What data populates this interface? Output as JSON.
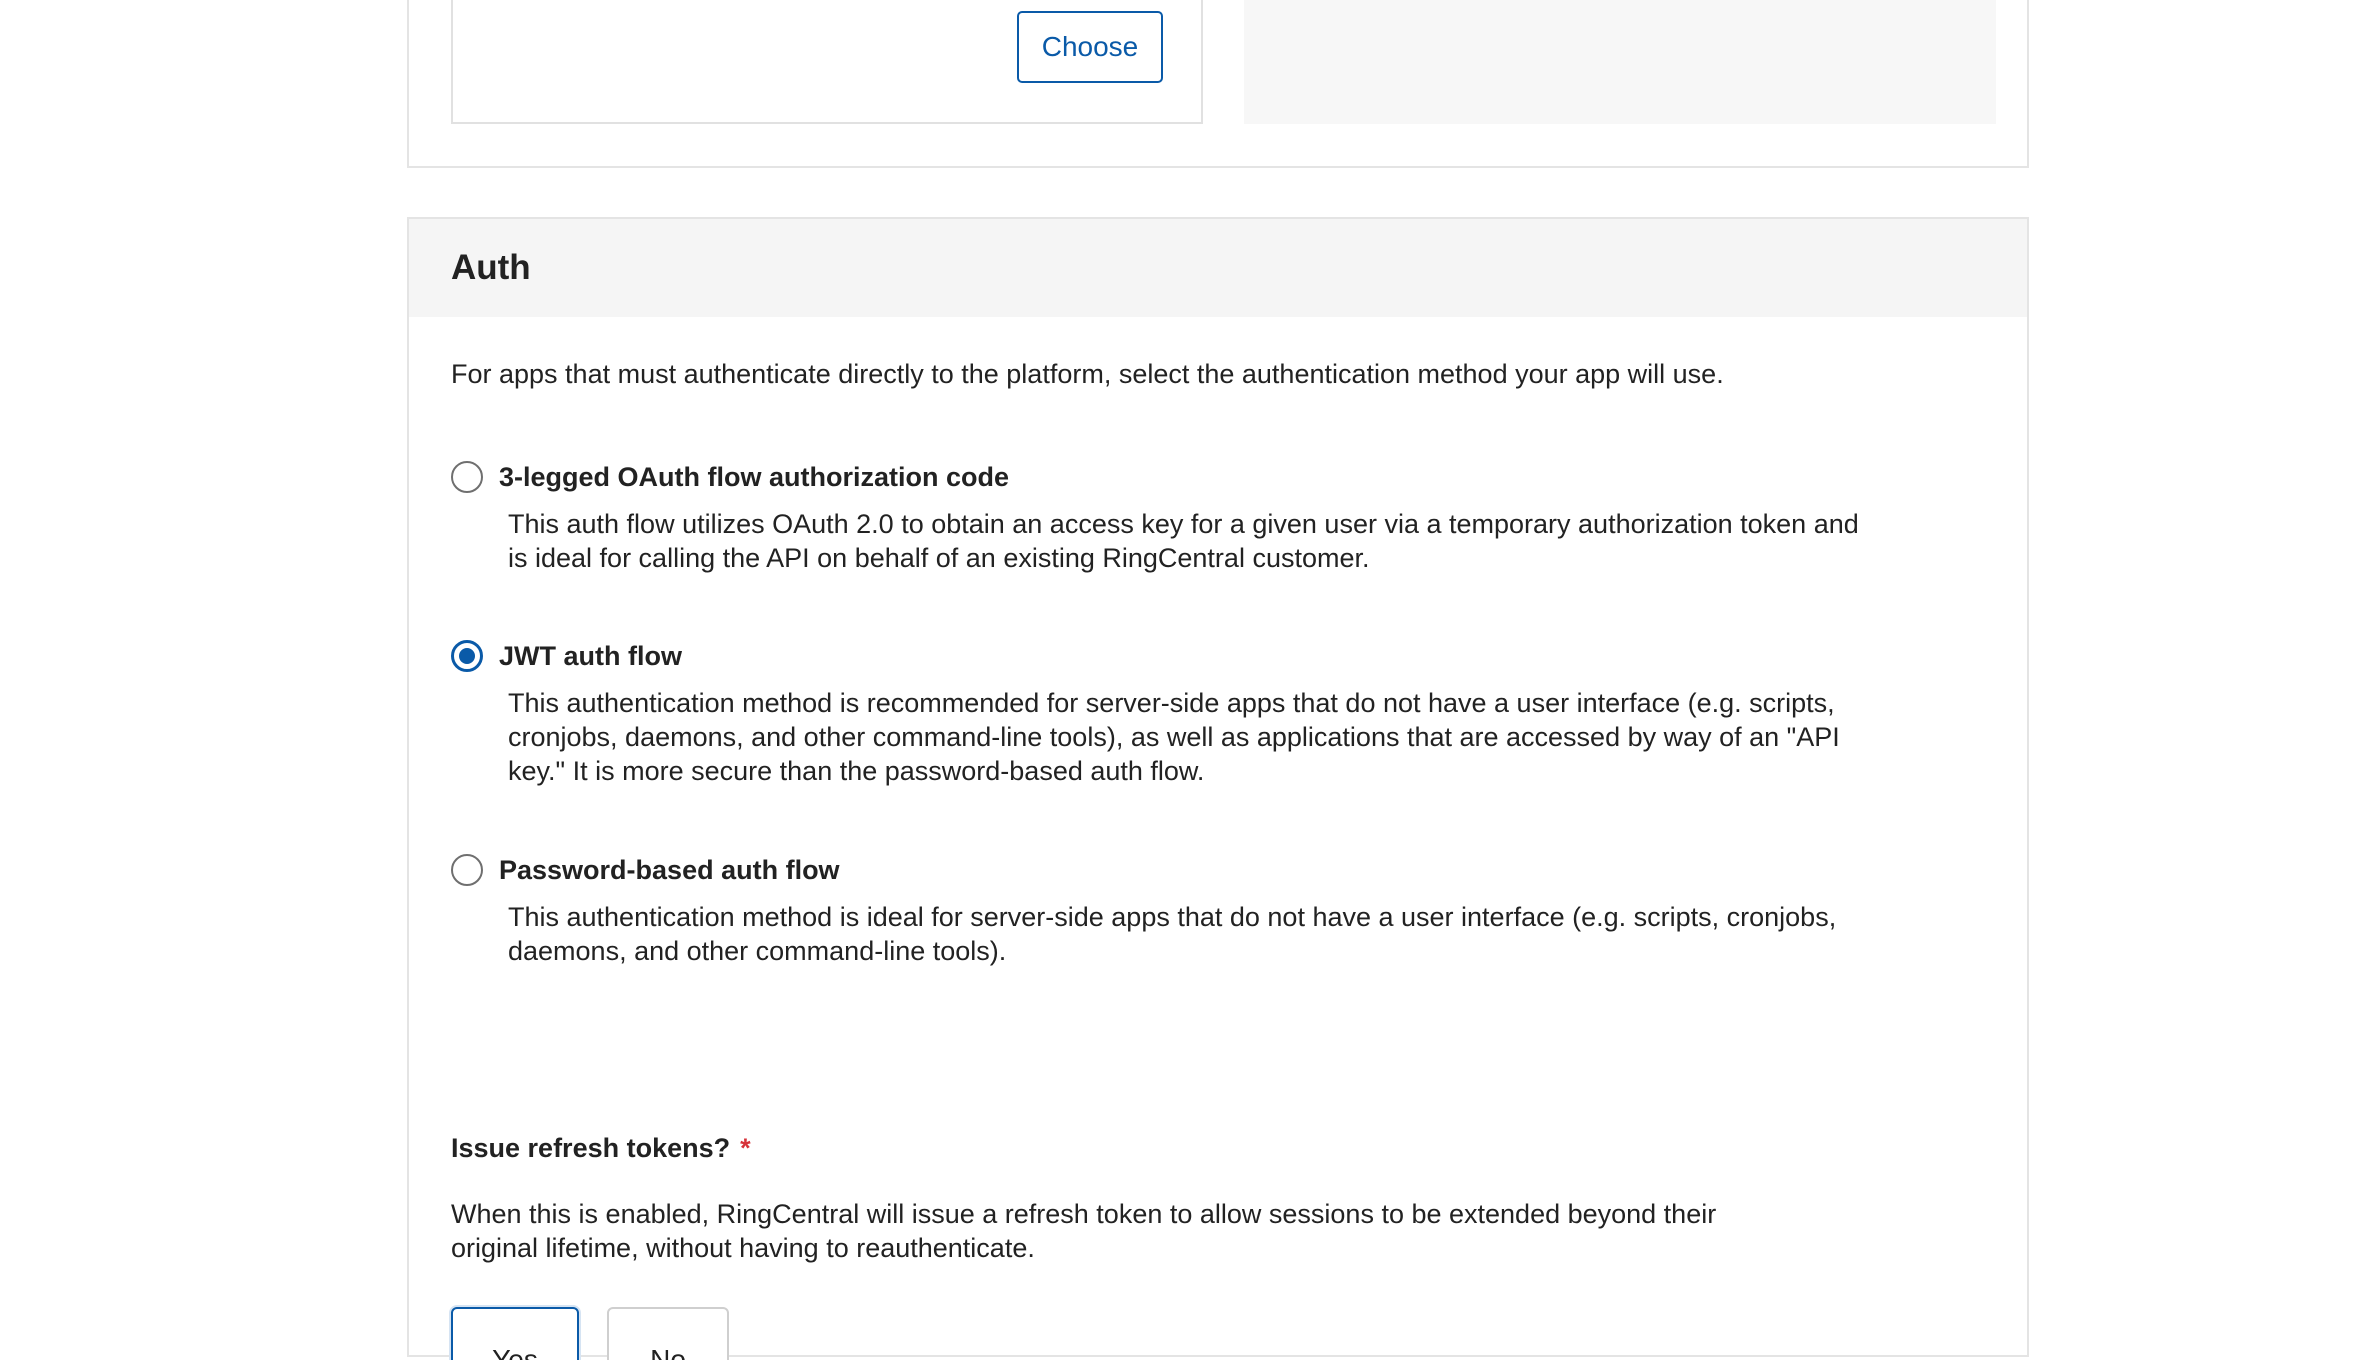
{
  "upload": {
    "choose_label": "Choose"
  },
  "auth": {
    "title": "Auth",
    "intro": "For apps that must authenticate directly to the platform, select the authentication method your app will use.",
    "options": [
      {
        "label": "3-legged OAuth flow authorization code",
        "description": "This auth flow utilizes OAuth 2.0 to obtain an access key for a given user via a temporary authorization token and is ideal for calling the API on behalf of an existing RingCentral customer.",
        "selected": false
      },
      {
        "label": "JWT auth flow",
        "description": "This authentication method is recommended for server-side apps that do not have a user interface (e.g. scripts, cronjobs, daemons, and other command-line tools), as well as applications that are accessed by way of an \"API key.\" It is more secure than the password-based auth flow.",
        "selected": true
      },
      {
        "label": "Password-based auth flow",
        "description": "This authentication method is ideal for server-side apps that do not have a user interface (e.g. scripts, cronjobs, daemons, and other command-line tools).",
        "selected": false
      }
    ],
    "refresh": {
      "label": "Issue refresh tokens?",
      "required_mark": "*",
      "description": "When this is enabled, RingCentral will issue a refresh token to allow sessions to be extended beyond their original lifetime, without having to reauthenticate.",
      "yes_label": "Yes",
      "no_label": "No",
      "selected": "Yes"
    }
  },
  "colors": {
    "accent": "#0a5aa8",
    "required": "#d6333a",
    "header_bg": "#f5f5f5",
    "border": "#e4e4e4"
  }
}
